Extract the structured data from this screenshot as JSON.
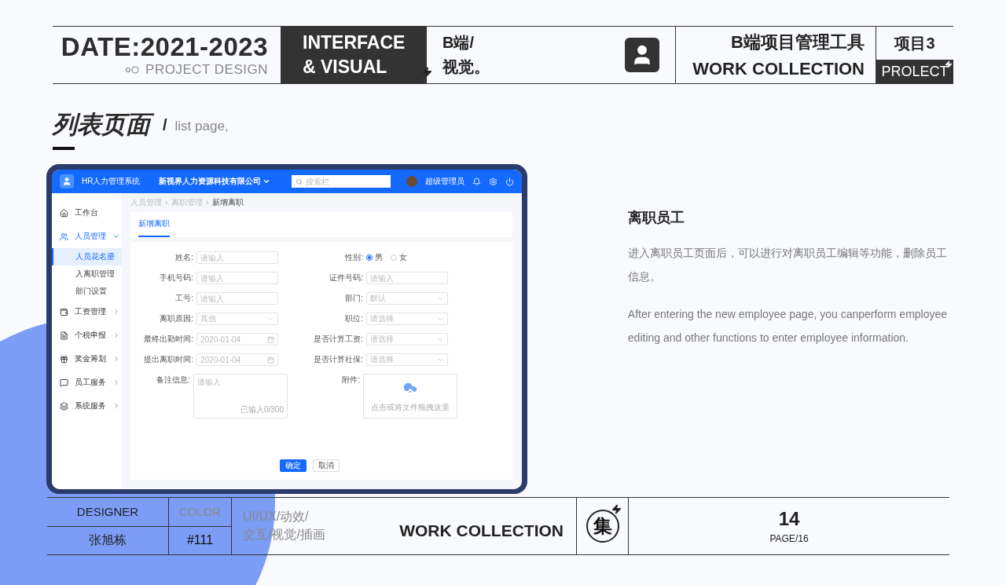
{
  "header": {
    "date": "DATE:2021-2023",
    "subtitle": "PROJECT DESIGN",
    "banner": [
      "INTERFACE",
      "& VISUAL"
    ],
    "tag": [
      "B端/",
      "视觉。"
    ],
    "title": "B端项目管理工具",
    "title_en": "WORK COLLECTION",
    "project": "项目3",
    "project_en": "PROLECT"
  },
  "section": {
    "title": "列表页面",
    "slash": "/",
    "subtitle": "list page,"
  },
  "mockup": {
    "app_title": "HR人力管理系统",
    "company": "新视界人力资源科技有限公司",
    "search": {
      "placeholder": "搜索栏"
    },
    "user": "超级管理员",
    "sidebar": [
      {
        "label": "工作台"
      },
      {
        "label": "人员管理",
        "expanded": true,
        "children": [
          {
            "label": "人员花名册",
            "selected": true
          },
          {
            "label": "入离职管理",
            "selected": false
          },
          {
            "label": "部门设置",
            "selected": false
          }
        ]
      },
      {
        "label": "工资管理",
        "expanded": false
      },
      {
        "label": "个税申报",
        "expanded": false
      },
      {
        "label": "奖金筹划",
        "expanded": false
      },
      {
        "label": "员工服务",
        "expanded": false
      },
      {
        "label": "系统服务",
        "expanded": false
      }
    ],
    "breadcrumb": [
      "人员管理",
      "离职管理",
      "新增离职"
    ],
    "tabs": [
      {
        "label": "新增离职",
        "selected": true
      }
    ],
    "fields": [
      {
        "label": "姓名:",
        "kind": "input",
        "placeholder": "请输入"
      },
      {
        "label": "性别:",
        "kind": "radio",
        "options": [
          {
            "label": "男",
            "selected": true
          },
          {
            "label": "女",
            "selected": false
          }
        ]
      },
      {
        "label": "手机号码:",
        "kind": "input",
        "placeholder": "请输入"
      },
      {
        "label": "证件号码:",
        "kind": "input",
        "placeholder": "请输入"
      },
      {
        "label": "工号:",
        "kind": "input",
        "placeholder": "请输入"
      },
      {
        "label": "部门:",
        "kind": "select",
        "placeholder": "默认"
      },
      {
        "label": "离职原因:",
        "kind": "select",
        "placeholder": "其他"
      },
      {
        "label": "职位:",
        "kind": "select",
        "placeholder": "请选择"
      },
      {
        "label": "最终出勤时间:",
        "kind": "date",
        "placeholder": "2020-01-04"
      },
      {
        "label": "是否计算工资:",
        "kind": "select",
        "placeholder": "请选择"
      },
      {
        "label": "提出离职时间:",
        "kind": "date",
        "placeholder": "2020-01-04"
      },
      {
        "label": "是否计算社保:",
        "kind": "select",
        "placeholder": "请选择"
      },
      {
        "label": "备注信息:",
        "kind": "textarea",
        "placeholder": "请输入",
        "counter": "已输入0/300"
      },
      {
        "label": "附件:",
        "kind": "upload",
        "hint": "点击或将文件拖拽这里"
      }
    ],
    "buttons": [
      {
        "label": "确定",
        "kind": "primary"
      },
      {
        "label": "取消",
        "kind": "default"
      }
    ]
  },
  "description": {
    "heading": "离职员工",
    "text_zh": "进入离职员工页面后，可以进行对离职员工编辑等功能，删除员工信息。",
    "text_en": "After entering the new employee page, you canperform employee editing and other functions to enter employee information."
  },
  "footer": {
    "designer_label": "DESIGNER",
    "designer": "张旭栋",
    "color_label": "COLOR",
    "color": "#111",
    "skills": [
      "UI/UX/动效/",
      "交互/视觉/插画"
    ],
    "work_collection": "WORK COLLECTION",
    "emblem": "集",
    "page": "14",
    "page_total": "PAGE/16"
  }
}
